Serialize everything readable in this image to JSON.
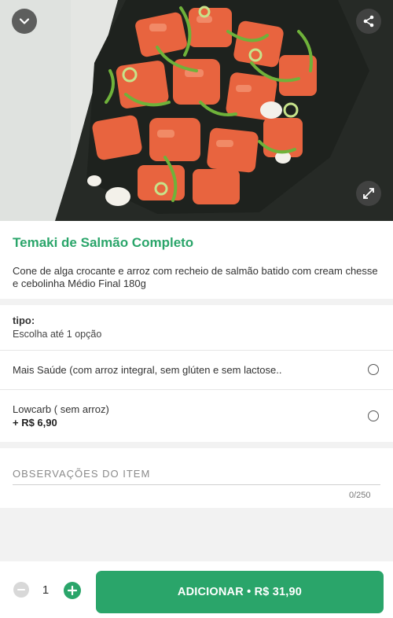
{
  "header": {
    "back_icon": "chevron-down-icon",
    "share_icon": "share-icon",
    "expand_icon": "expand-icon"
  },
  "product": {
    "title": "Temaki de Salmão Completo",
    "description": "Cone de alga crocante e arroz com recheio de salmão batido com cream chesse e cebolinha Médio Final 180g"
  },
  "option_group": {
    "label": "tipo:",
    "hint": "Escolha até 1 opção",
    "options": [
      {
        "label": "Mais Saúde (com arroz integral, sem glúten e sem lactose..",
        "price": "",
        "selected": false
      },
      {
        "label": "Lowcarb ( sem arroz)",
        "price": "+ R$ 6,90",
        "selected": false
      }
    ]
  },
  "notes": {
    "placeholder": "OBSERVAÇÕES DO ITEM",
    "value": "",
    "counter": "0/250"
  },
  "footer": {
    "quantity": "1",
    "add_label": "ADICIONAR • R$ 31,90"
  },
  "colors": {
    "accent": "#2aa56a",
    "text": "#333333",
    "background": "#f2f2f2"
  }
}
